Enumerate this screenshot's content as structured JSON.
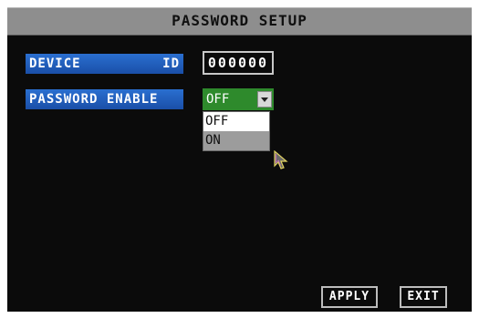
{
  "title": "PASSWORD SETUP",
  "device": {
    "label_left": "DEVICE",
    "label_right": "ID",
    "value": "000000"
  },
  "password_enable": {
    "label": "PASSWORD ENABLE",
    "selected": "OFF",
    "options": [
      "OFF",
      "ON"
    ],
    "highlighted_option": "OFF"
  },
  "buttons": {
    "apply": "APPLY",
    "exit": "EXIT"
  },
  "icons": {
    "dropdown_arrow": "chevron-down-icon",
    "pointer": "mouse-pointer-icon"
  },
  "colors": {
    "background": "#0b0b0b",
    "title_bar": "#8e8e8e",
    "label_blue": "#2a6fd0",
    "select_green": "#2e8a2c",
    "pointer_accent": "#e0d060"
  }
}
